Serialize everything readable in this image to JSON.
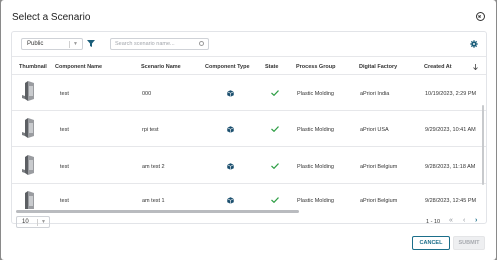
{
  "dialog": {
    "title": "Select a Scenario"
  },
  "toolbar": {
    "visibility_value": "Public",
    "search_placeholder": "Search scenario name..."
  },
  "table": {
    "columns": [
      "Thumbnail",
      "Component Name",
      "Scenario Name",
      "Component Type",
      "State",
      "Process Group",
      "Digital Factory",
      "Created At"
    ],
    "rows": [
      {
        "component": "test",
        "scenario": "000",
        "process_group": "Plastic Molding",
        "factory": "aPriori India",
        "created": "10/19/2023, 2:29 PM"
      },
      {
        "component": "test",
        "scenario": "rpi test",
        "process_group": "Plastic Molding",
        "factory": "aPriori USA",
        "created": "9/29/2023, 10:41 AM"
      },
      {
        "component": "test",
        "scenario": "am test 2",
        "process_group": "Plastic Molding",
        "factory": "aPriori Belgium",
        "created": "9/28/2023, 11:18 AM"
      },
      {
        "component": "test",
        "scenario": "am test 1",
        "process_group": "Plastic Molding",
        "factory": "aPriori Belgium",
        "created": "9/28/2023, 12:45 PM"
      }
    ]
  },
  "pagination": {
    "page_size": "10",
    "range": "1 - 10"
  },
  "footer": {
    "cancel_label": "CANCEL",
    "submit_label": "SUBMIT"
  },
  "colors": {
    "accent": "#1b6e8a",
    "check": "#2e9e45",
    "backdrop": "#8a8a8a"
  },
  "icons": [
    "close-icon",
    "chevron-down-icon",
    "filter-icon",
    "search-icon",
    "gear-icon",
    "part-thumbnail",
    "cube-icon",
    "check-icon",
    "sort-arrow-icon",
    "first-page-icon",
    "prev-page-icon",
    "next-page-icon"
  ]
}
